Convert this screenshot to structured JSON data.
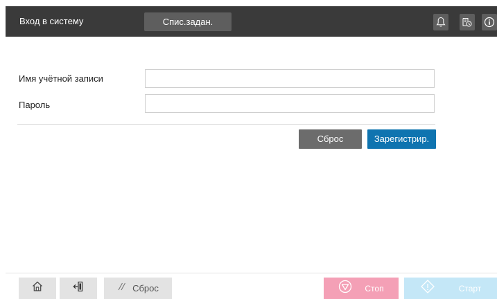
{
  "header": {
    "title": "Вход в систему",
    "tab_label": "Спис.задан.",
    "icons": [
      "bell-icon",
      "job-status-icon",
      "info-icon"
    ]
  },
  "form": {
    "account_label": "Имя учётной записи",
    "account_value": "",
    "password_label": "Пароль",
    "password_value": "",
    "reset_button": "Сброс",
    "register_button": "Зарегистрир."
  },
  "footer": {
    "home_icon": "home-icon",
    "logout_icon": "logout-icon",
    "reset_label": "Сброс",
    "stop_label": "Стоп",
    "start_label": "Старт"
  },
  "colors": {
    "header_bg": "#3a3a3a",
    "tab_bg": "#5e5e5e",
    "register_bg": "#0f74b0",
    "reset_bg": "#6c6c6c",
    "stop_bg": "#f4a0b6",
    "start_bg": "#c4e7f7"
  }
}
